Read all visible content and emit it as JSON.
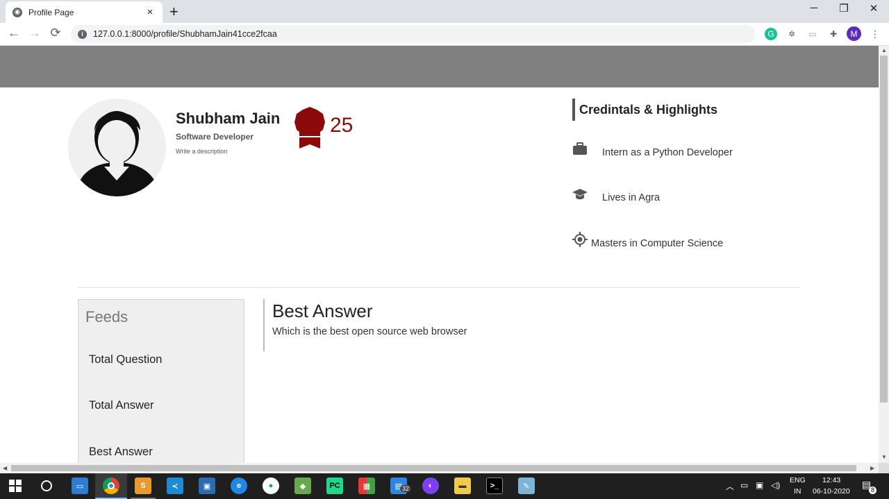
{
  "browser": {
    "tab_title": "Profile Page",
    "tab_close": "×",
    "new_tab": "+",
    "url": "127.0.0.1:8000/profile/ShubhamJain41cce2fcaa",
    "window_controls": {
      "minimize": "─",
      "restore": "❐",
      "close": "✕"
    },
    "nav": {
      "back": "←",
      "forward": "→",
      "reload": "⟳"
    },
    "profile_initial": "M"
  },
  "profile": {
    "name": "Shubham Jain",
    "role": "Software Developer",
    "description_placeholder": "Write a description",
    "points": "25",
    "badge_color": "#8b0a0a"
  },
  "credentials": {
    "title": "Credintals & Highlights",
    "items": [
      {
        "icon": "briefcase-icon",
        "text": "Intern as a Python Developer"
      },
      {
        "icon": "graduation-cap-icon",
        "text": "Lives in Agra"
      },
      {
        "icon": "location-target-icon",
        "text": "Masters in Computer Science"
      }
    ]
  },
  "feeds": {
    "title": "Feeds",
    "items": [
      "Total Question",
      "Total Answer",
      "Best Answer"
    ]
  },
  "main": {
    "section_title": "Best Answer",
    "question": "Which is the best open source web browser"
  },
  "taskbar": {
    "language": "ENG",
    "region": "IN",
    "time": "12:43",
    "date": "06-10-2020",
    "notification_count": "8",
    "app_badge": "32"
  }
}
